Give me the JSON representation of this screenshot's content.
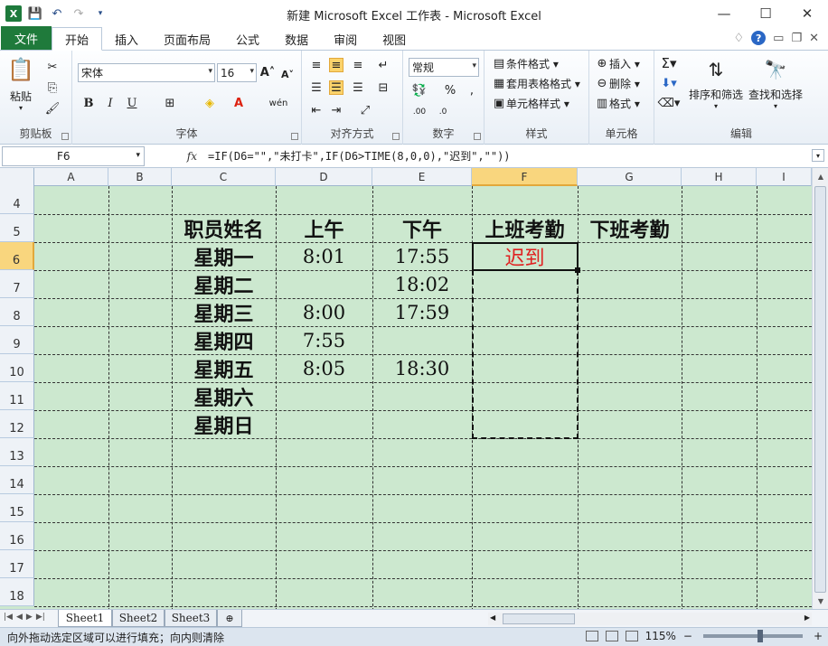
{
  "window": {
    "title": "新建 Microsoft Excel 工作表 - Microsoft Excel",
    "app_icon": "X"
  },
  "tabs": {
    "file": "文件",
    "items": [
      "开始",
      "插入",
      "页面布局",
      "公式",
      "数据",
      "审阅",
      "视图"
    ]
  },
  "ribbon": {
    "clipboard": {
      "label": "剪贴板",
      "paste": "粘贴"
    },
    "font": {
      "label": "字体",
      "name": "宋体",
      "size": "16"
    },
    "alignment": {
      "label": "对齐方式"
    },
    "number": {
      "label": "数字",
      "format": "常规"
    },
    "styles": {
      "label": "样式",
      "conditional": "条件格式",
      "table": "套用表格格式",
      "cell": "单元格样式"
    },
    "cells": {
      "label": "单元格",
      "insert": "插入",
      "delete": "删除",
      "format": "格式"
    },
    "editing": {
      "label": "编辑",
      "sort": "排序和筛选",
      "find": "查找和选择"
    }
  },
  "formula_bar": {
    "name_box": "F6",
    "fx": "fx",
    "formula": "=IF(D6=\"\",\"未打卡\",IF(D6>TIME(8,0,0),\"迟到\",\"\"))"
  },
  "grid": {
    "columns": [
      "A",
      "B",
      "C",
      "D",
      "E",
      "F",
      "G",
      "H",
      "I"
    ],
    "rows": [
      "4",
      "5",
      "6",
      "7",
      "8",
      "9",
      "10",
      "11",
      "12",
      "13",
      "14",
      "15",
      "16",
      "17",
      "18"
    ],
    "header_row": {
      "C": "职员姓名",
      "D": "上午",
      "E": "下午",
      "F": "上班考勤",
      "G": "下班考勤"
    },
    "data": [
      {
        "name": "星期一",
        "am": "8:01",
        "pm": "17:55",
        "check_in": "迟到"
      },
      {
        "name": "星期二",
        "am": "",
        "pm": "18:02",
        "check_in": ""
      },
      {
        "name": "星期三",
        "am": "8:00",
        "pm": "17:59",
        "check_in": ""
      },
      {
        "name": "星期四",
        "am": "7:55",
        "pm": "",
        "check_in": ""
      },
      {
        "name": "星期五",
        "am": "8:05",
        "pm": "18:30",
        "check_in": ""
      },
      {
        "name": "星期六",
        "am": "",
        "pm": "",
        "check_in": ""
      },
      {
        "name": "星期日",
        "am": "",
        "pm": "",
        "check_in": ""
      }
    ],
    "late_color": "#e02020",
    "fill_color": "#cce8cf"
  },
  "sheets": [
    "Sheet1",
    "Sheet2",
    "Sheet3"
  ],
  "status": {
    "message": "向外拖动选定区域可以进行填充；向内则清除",
    "zoom": "115%"
  }
}
